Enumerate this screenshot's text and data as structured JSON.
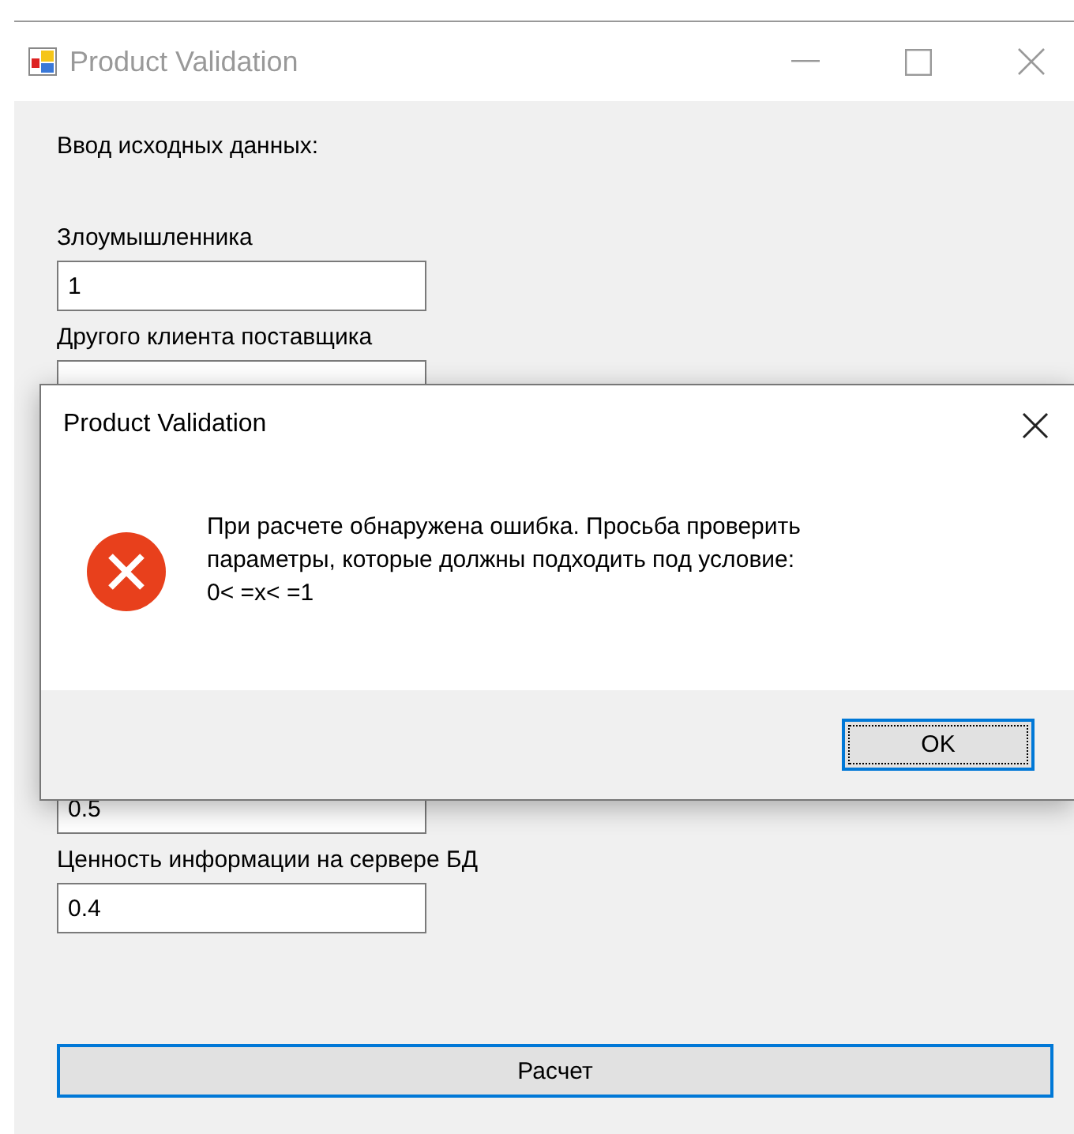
{
  "window": {
    "title": "Product Validation"
  },
  "form": {
    "heading": "Ввод исходных данных:",
    "fields": [
      {
        "label": "Злоумышленника",
        "value": "1"
      },
      {
        "label": "Другого клиента поставщика"
      },
      {
        "value": "0.5"
      },
      {
        "label": "Ценность информации на сервере БД",
        "value": "0.4"
      }
    ],
    "button": "Расчет"
  },
  "dialog": {
    "title": "Product Validation",
    "kind": "error",
    "message": "При расчете обнаружена ошибка. Просьба проверить\nпараметры, которые должны подходить под условие:\n0< =x< =1",
    "button": "OK"
  }
}
